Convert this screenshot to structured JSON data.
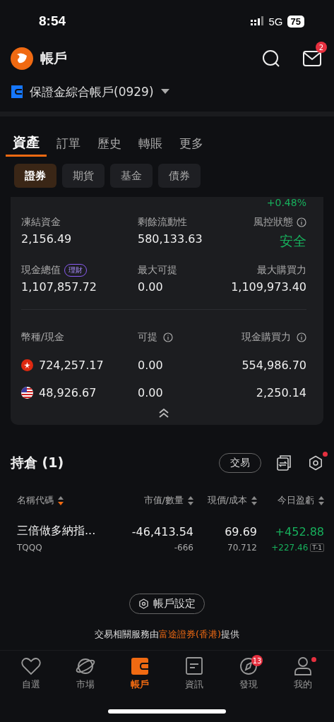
{
  "status_bar": {
    "time": "8:54",
    "network": "5G",
    "battery": "75"
  },
  "header": {
    "title": "帳戶",
    "mail_badge": "2"
  },
  "account": {
    "name": "保證金綜合帳戶(0929)"
  },
  "tabs": [
    {
      "label": "資產",
      "selected": true
    },
    {
      "label": "訂單",
      "selected": false
    },
    {
      "label": "歷史",
      "selected": false
    },
    {
      "label": "轉賬",
      "selected": false
    },
    {
      "label": "更多",
      "selected": false
    }
  ],
  "sub_tabs": [
    {
      "label": "證券",
      "selected": true
    },
    {
      "label": "期貨",
      "selected": false
    },
    {
      "label": "基金",
      "selected": false
    },
    {
      "label": "債券",
      "selected": false
    }
  ],
  "summary": {
    "change": "+0.48%",
    "metrics": [
      {
        "label": "凍結資金",
        "value": "2,156.49",
        "info": false,
        "positive": false
      },
      {
        "label": "剩餘流動性",
        "value": "580,133.63",
        "info": false,
        "positive": false
      },
      {
        "label": "風控狀態",
        "value": "安全",
        "info": true,
        "positive": true
      },
      {
        "label": "現金總值",
        "value": "1,107,857.72",
        "info": false,
        "badge": "理財",
        "positive": false
      },
      {
        "label": "最大可提",
        "value": "0.00",
        "info": false,
        "positive": false
      },
      {
        "label": "最大購買力",
        "value": "1,109,973.40",
        "info": false,
        "positive": false
      }
    ]
  },
  "currency_table": {
    "columns": [
      {
        "label": "幣種/現金",
        "info": false
      },
      {
        "label": "可提",
        "info": true
      },
      {
        "label": "現金購買力",
        "info": true
      }
    ],
    "rows": [
      {
        "kind": "hkd",
        "cash": "724,257.17",
        "withdrawable": "0.00",
        "buying_power": "554,986.70"
      },
      {
        "kind": "usd",
        "cash": "48,926.67",
        "withdrawable": "0.00",
        "buying_power": "2,250.14"
      }
    ]
  },
  "holdings": {
    "title": "持倉 (1)",
    "trade_button": "交易",
    "settings_dot": true,
    "columns": [
      {
        "label": "名稱代碼",
        "sort_active": true
      },
      {
        "label": "市值/數量",
        "sort_active": false
      },
      {
        "label": "現價/成本",
        "sort_active": false
      },
      {
        "label": "今日盈虧",
        "sort_active": false
      }
    ],
    "rows": [
      {
        "name": "三倍做多納指...",
        "code": "TQQQ",
        "market_value": "-46,413.54",
        "quantity": "-666",
        "price": "69.69",
        "cost": "70.712",
        "pnl_today": "+452.88",
        "pnl_t1": "+227.46",
        "t1_tag": "T-1"
      }
    ]
  },
  "settings_button": "帳戶設定",
  "footer": {
    "prefix": "交易相關服務由",
    "link": "富途證券(香港)",
    "suffix": "提供"
  },
  "nav": [
    {
      "kind": "heart",
      "label": "自選",
      "selected": false
    },
    {
      "kind": "planet",
      "label": "市場",
      "selected": false
    },
    {
      "kind": "wallet",
      "label": "帳戶",
      "selected": true
    },
    {
      "kind": "news",
      "label": "資訊",
      "selected": false
    },
    {
      "kind": "compass",
      "label": "發現",
      "selected": false,
      "badge": "13"
    },
    {
      "kind": "person",
      "label": "我的",
      "selected": false,
      "dot": true
    }
  ]
}
